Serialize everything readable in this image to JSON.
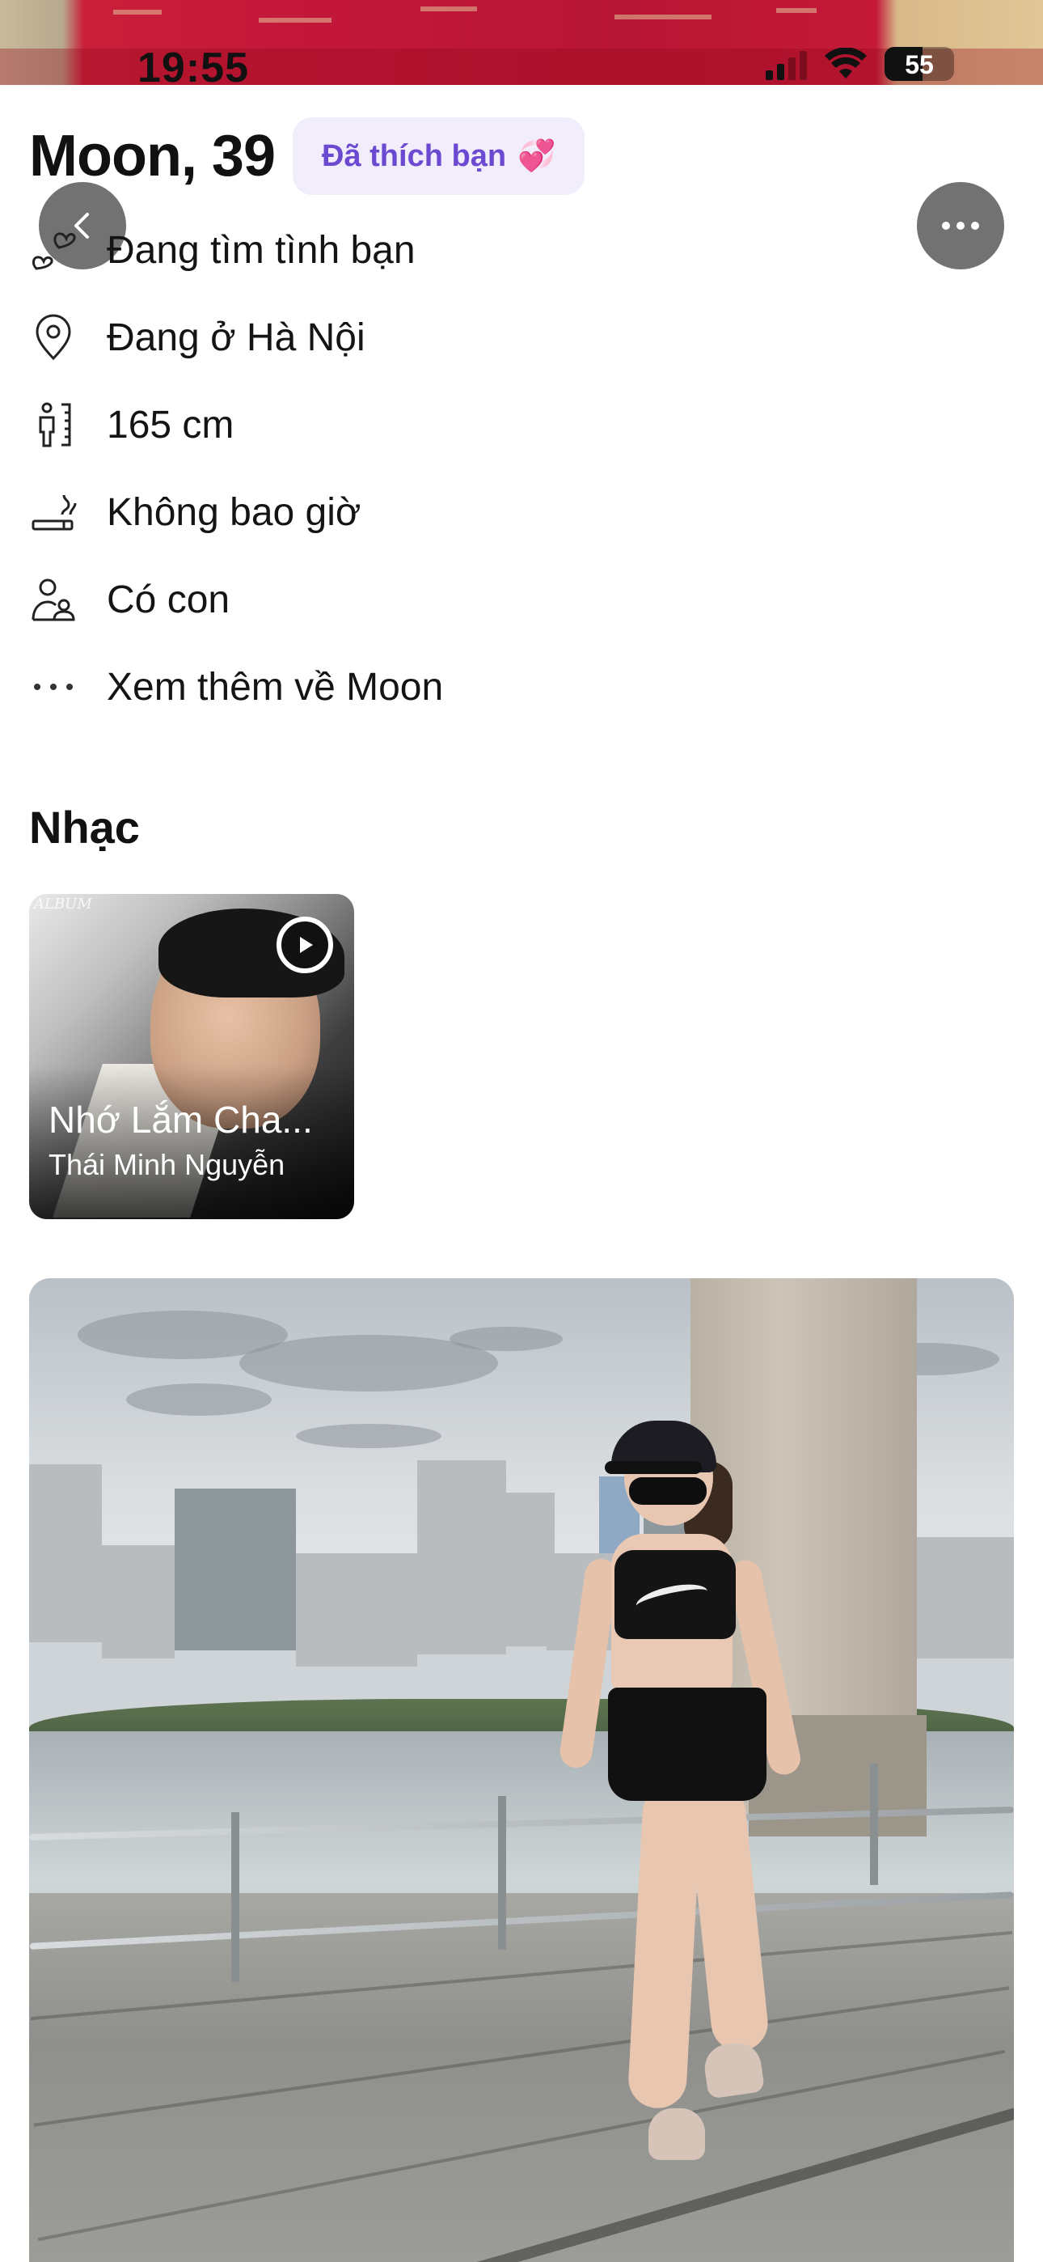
{
  "status_bar": {
    "time": "19:55",
    "battery": "55"
  },
  "profile": {
    "name_age": "Moon, 39",
    "liked_badge": "Đã thích bạn",
    "liked_badge_emoji": "💞",
    "accent_color": "#6b4ad1",
    "badge_bg": "#f1edfb"
  },
  "info_items": [
    {
      "icon": "hearts-icon",
      "text": "Đang tìm tình bạn"
    },
    {
      "icon": "location-pin-icon",
      "text": "Đang ở Hà Nội"
    },
    {
      "icon": "height-icon",
      "text": "165 cm"
    },
    {
      "icon": "smoking-icon",
      "text": "Không bao giờ"
    },
    {
      "icon": "children-icon",
      "text": "Có con"
    },
    {
      "icon": "more-dots-icon",
      "text": "Xem thêm về Moon"
    }
  ],
  "music": {
    "section_title": "Nhạc",
    "song_title": "Nhớ Lắm Cha...",
    "artist": "Thái Minh Nguyễn",
    "album_mark": "ALBUM"
  }
}
